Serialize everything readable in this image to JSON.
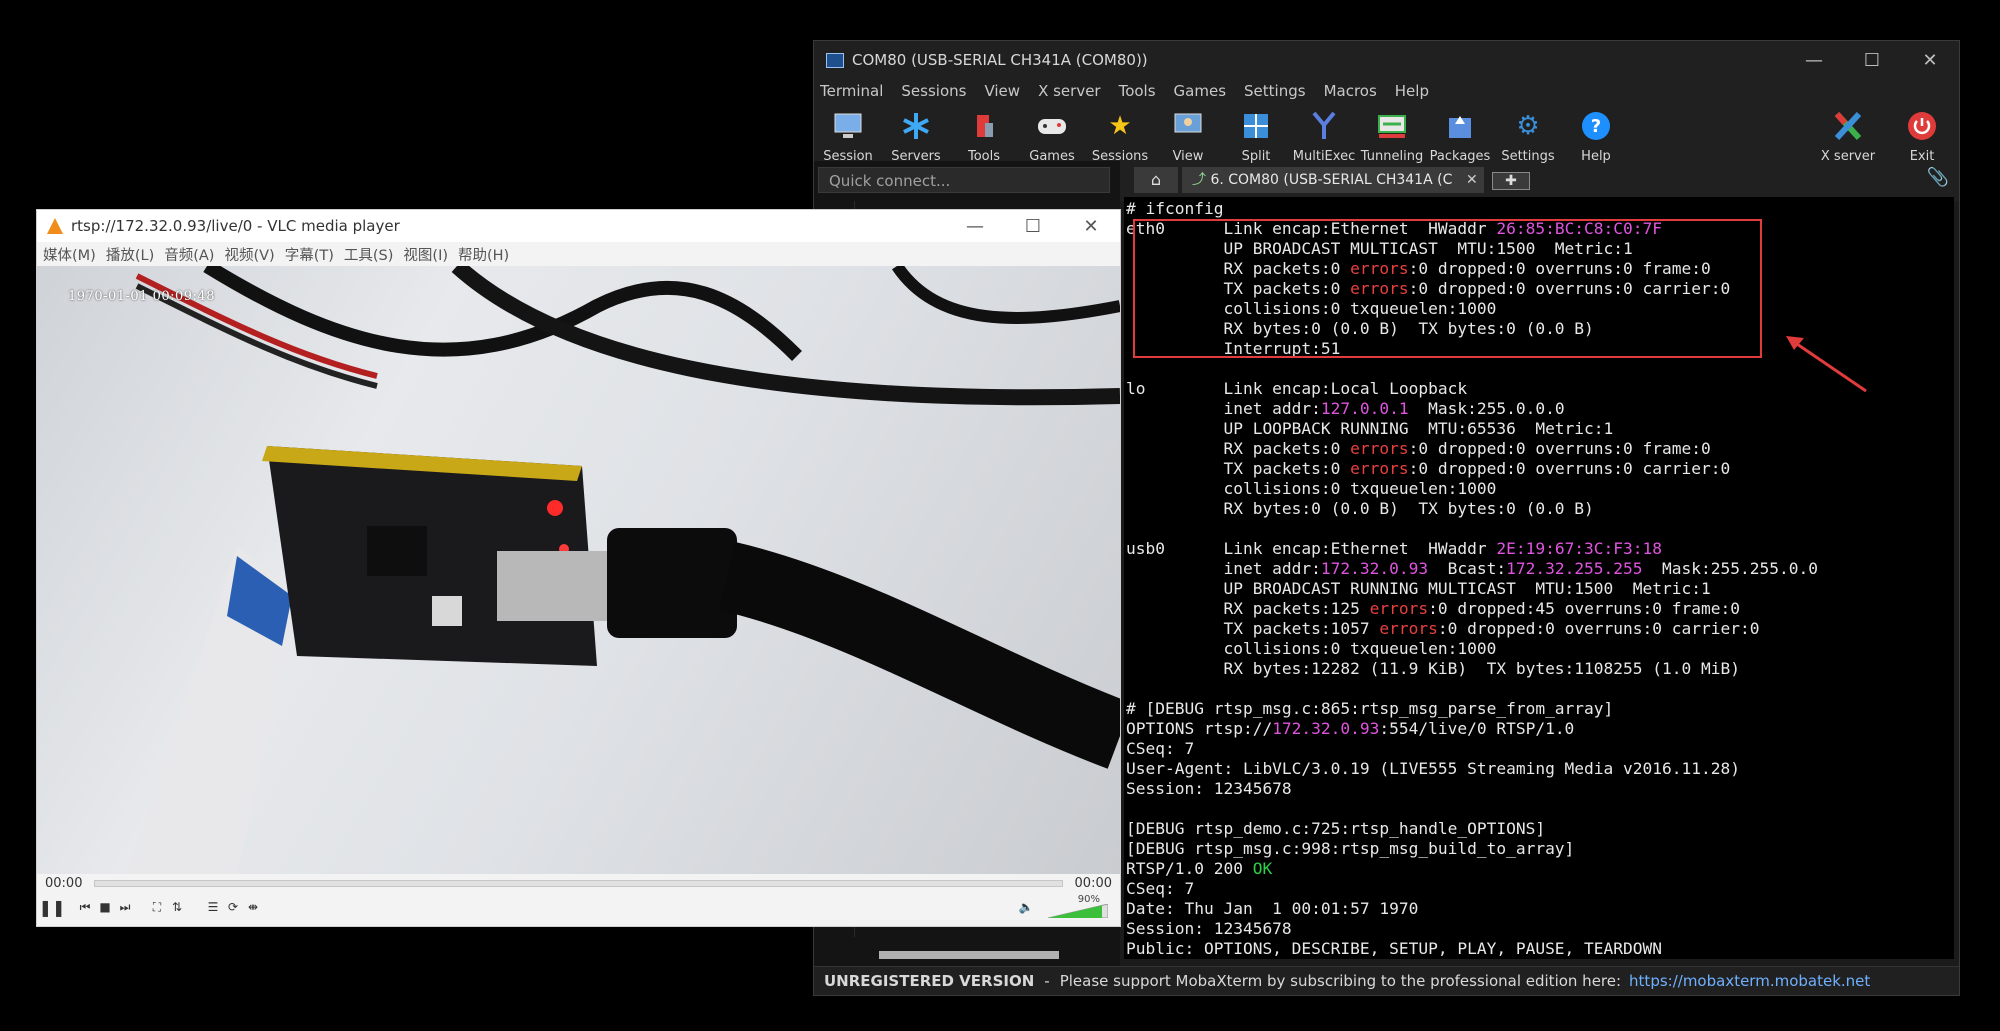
{
  "moba": {
    "title": "COM80  (USB-SERIAL CH341A (COM80))",
    "menu": [
      "Terminal",
      "Sessions",
      "View",
      "X server",
      "Tools",
      "Games",
      "Settings",
      "Macros",
      "Help"
    ],
    "toolbar": [
      {
        "label": "Session",
        "icon": "session-icon"
      },
      {
        "label": "Servers",
        "icon": "servers-icon"
      },
      {
        "label": "Tools",
        "icon": "tools-icon"
      },
      {
        "label": "Games",
        "icon": "games-icon"
      },
      {
        "label": "Sessions",
        "icon": "star-icon"
      },
      {
        "label": "View",
        "icon": "view-icon"
      },
      {
        "label": "Split",
        "icon": "split-icon"
      },
      {
        "label": "MultiExec",
        "icon": "multiexec-icon"
      },
      {
        "label": "Tunneling",
        "icon": "tunneling-icon"
      },
      {
        "label": "Packages",
        "icon": "packages-icon"
      },
      {
        "label": "Settings",
        "icon": "settings-icon"
      },
      {
        "label": "Help",
        "icon": "help-icon"
      },
      {
        "label": "X server",
        "icon": "xserver-icon"
      },
      {
        "label": "Exit",
        "icon": "power-icon"
      }
    ],
    "quick_connect": "Quick connect...",
    "tab_label": "6. COM80  (USB-SERIAL CH341A (C",
    "status": {
      "unregistered": "UNREGISTERED VERSION",
      "sep": "-",
      "message": "Please support MobaXterm by subscribing to the professional edition here:",
      "link": "https://mobaxterm.mobatek.net"
    },
    "colors": {
      "accent_magenta": "#e054e0",
      "error_red": "#e84040",
      "ok_green": "#2dd04a",
      "highlight": "#e23b3b"
    }
  },
  "terminal": {
    "lines": [
      [
        {
          "t": "# ifconfig"
        }
      ],
      [
        {
          "t": "eth0      Link encap:Ethernet  HWaddr "
        },
        {
          "t": "26:85:BC:C8:C0:7F",
          "c": "mag"
        }
      ],
      [
        {
          "t": "          UP BROADCAST MULTICAST  MTU:1500  Metric:1"
        }
      ],
      [
        {
          "t": "          RX packets:0 "
        },
        {
          "t": "errors",
          "c": "red"
        },
        {
          "t": ":0 dropped:0 overruns:0 frame:0"
        }
      ],
      [
        {
          "t": "          TX packets:0 "
        },
        {
          "t": "errors",
          "c": "red"
        },
        {
          "t": ":0 dropped:0 overruns:0 carrier:0"
        }
      ],
      [
        {
          "t": "          collisions:0 txqueuelen:1000"
        }
      ],
      [
        {
          "t": "          RX bytes:0 (0.0 B)  TX bytes:0 (0.0 B)"
        }
      ],
      [
        {
          "t": "          Interrupt:51"
        }
      ],
      [
        {
          "t": ""
        }
      ],
      [
        {
          "t": "lo        Link encap:Local Loopback"
        }
      ],
      [
        {
          "t": "          inet addr:"
        },
        {
          "t": "127.0.0.1",
          "c": "mag"
        },
        {
          "t": "  Mask:255.0.0.0"
        }
      ],
      [
        {
          "t": "          UP LOOPBACK RUNNING  MTU:65536  Metric:1"
        }
      ],
      [
        {
          "t": "          RX packets:0 "
        },
        {
          "t": "errors",
          "c": "red"
        },
        {
          "t": ":0 dropped:0 overruns:0 frame:0"
        }
      ],
      [
        {
          "t": "          TX packets:0 "
        },
        {
          "t": "errors",
          "c": "red"
        },
        {
          "t": ":0 dropped:0 overruns:0 carrier:0"
        }
      ],
      [
        {
          "t": "          collisions:0 txqueuelen:1000"
        }
      ],
      [
        {
          "t": "          RX bytes:0 (0.0 B)  TX bytes:0 (0.0 B)"
        }
      ],
      [
        {
          "t": ""
        }
      ],
      [
        {
          "t": "usb0      Link encap:Ethernet  HWaddr "
        },
        {
          "t": "2E:19:67:3C:F3:18",
          "c": "mag"
        }
      ],
      [
        {
          "t": "          inet addr:"
        },
        {
          "t": "172.32.0.93",
          "c": "mag"
        },
        {
          "t": "  Bcast:"
        },
        {
          "t": "172.32.255.255",
          "c": "mag"
        },
        {
          "t": "  Mask:255.255.0.0"
        }
      ],
      [
        {
          "t": "          UP BROADCAST RUNNING MULTICAST  MTU:1500  Metric:1"
        }
      ],
      [
        {
          "t": "          RX packets:125 "
        },
        {
          "t": "errors",
          "c": "red"
        },
        {
          "t": ":0 dropped:45 overruns:0 frame:0"
        }
      ],
      [
        {
          "t": "          TX packets:1057 "
        },
        {
          "t": "errors",
          "c": "red"
        },
        {
          "t": ":0 dropped:0 overruns:0 carrier:0"
        }
      ],
      [
        {
          "t": "          collisions:0 txqueuelen:1000"
        }
      ],
      [
        {
          "t": "          RX bytes:12282 (11.9 KiB)  TX bytes:1108255 (1.0 MiB)"
        }
      ],
      [
        {
          "t": ""
        }
      ],
      [
        {
          "t": "# [DEBUG rtsp_msg.c:865:rtsp_msg_parse_from_array]"
        }
      ],
      [
        {
          "t": "OPTIONS rtsp://"
        },
        {
          "t": "172.32.0.93",
          "c": "mag"
        },
        {
          "t": ":554/live/0 RTSP/1.0"
        }
      ],
      [
        {
          "t": "CSeq: 7"
        }
      ],
      [
        {
          "t": "User-Agent: LibVLC/3.0.19 (LIVE555 Streaming Media v2016.11.28)"
        }
      ],
      [
        {
          "t": "Session: 12345678"
        }
      ],
      [
        {
          "t": ""
        }
      ],
      [
        {
          "t": "[DEBUG rtsp_demo.c:725:rtsp_handle_OPTIONS]"
        }
      ],
      [
        {
          "t": "[DEBUG rtsp_msg.c:998:rtsp_msg_build_to_array]"
        }
      ],
      [
        {
          "t": "RTSP/1.0 200 "
        },
        {
          "t": "OK",
          "c": "grn"
        }
      ],
      [
        {
          "t": "CSeq: 7"
        }
      ],
      [
        {
          "t": "Date: Thu Jan  1 00:01:57 1970"
        }
      ],
      [
        {
          "t": "Session: 12345678"
        }
      ],
      [
        {
          "t": "Public: OPTIONS, DESCRIBE, SETUP, PLAY, PAUSE, TEARDOWN"
        }
      ]
    ]
  },
  "vlc": {
    "title": "rtsp://172.32.0.93/live/0 - VLC media player",
    "menu": [
      "媒体(M)",
      "播放(L)",
      "音频(A)",
      "视频(V)",
      "字幕(T)",
      "工具(S)",
      "视图(I)",
      "帮助(H)"
    ],
    "osd": "1970-01-01  00:09:48",
    "elapsed": "00:00",
    "total": "00:00",
    "volume": "90%",
    "volume_level": 0.9,
    "colors": {
      "cone": "#f08c1a",
      "volume": "#3cc03c"
    }
  }
}
